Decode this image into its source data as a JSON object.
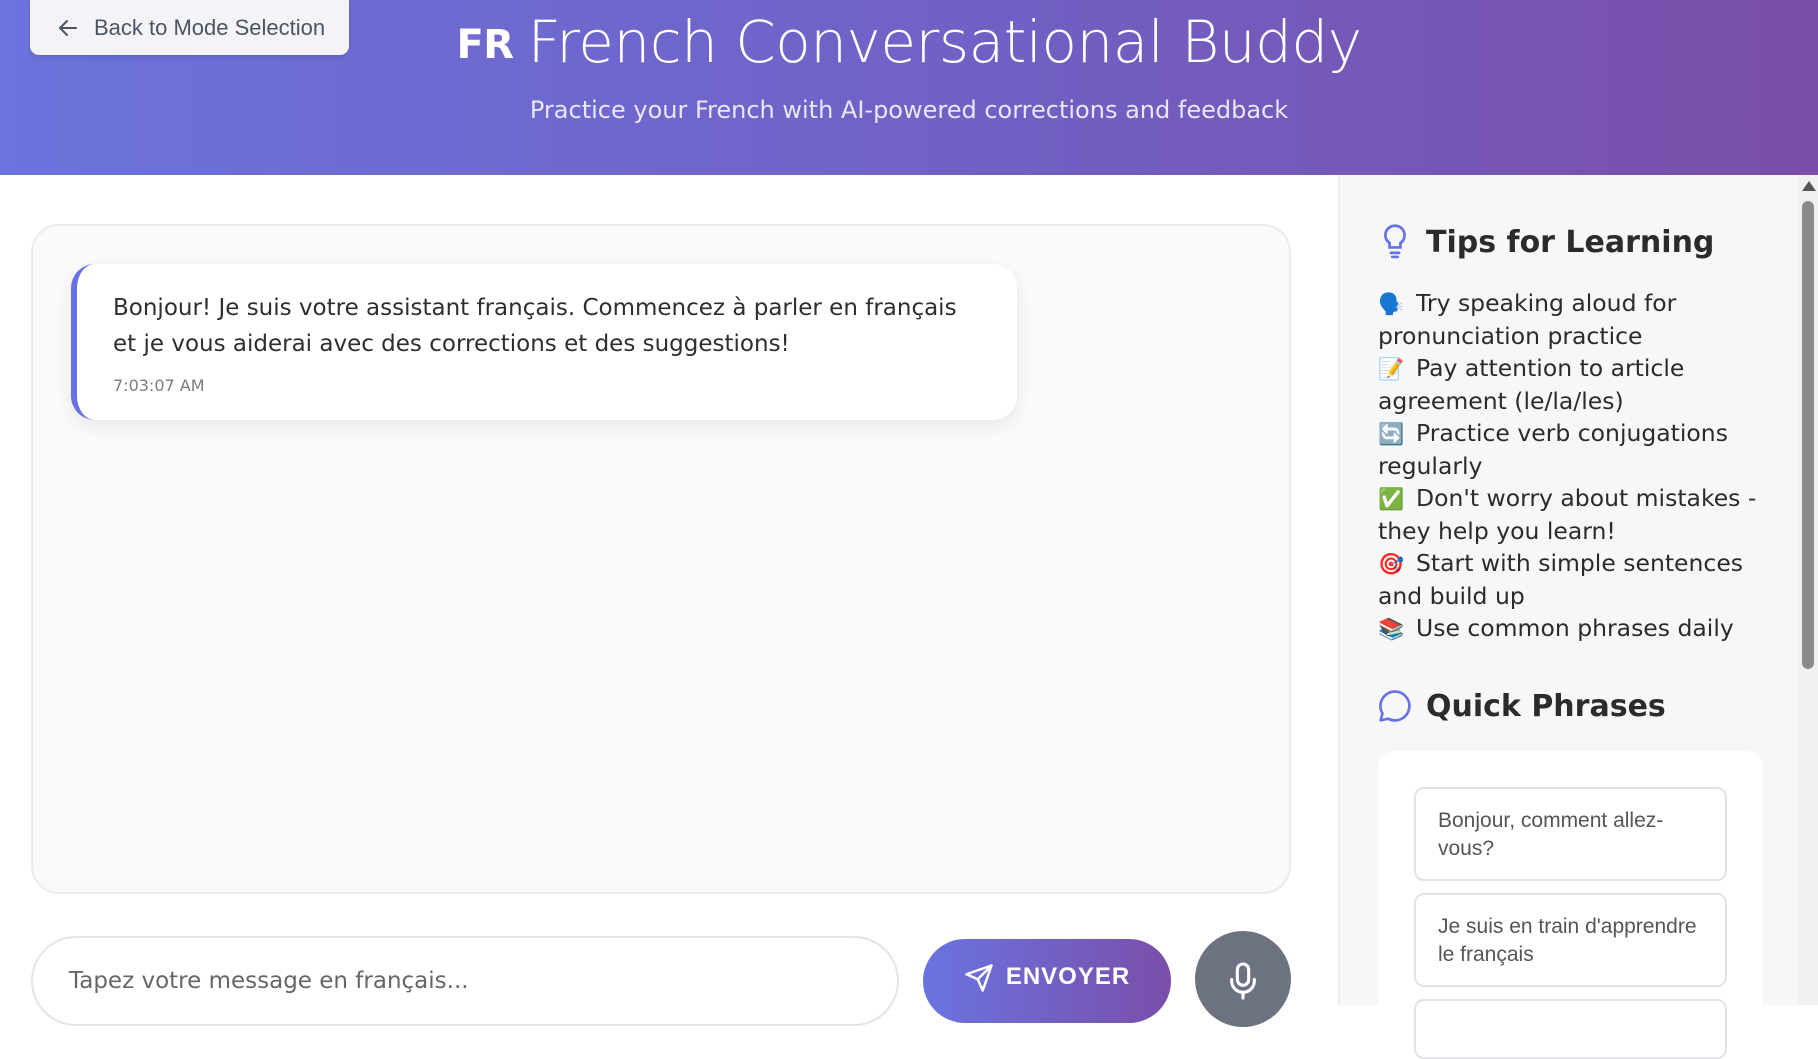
{
  "header": {
    "back_label": "Back to Mode Selection",
    "flag": "FR",
    "title": "French Conversational Buddy",
    "subtitle": "Practice your French with AI-powered corrections and feedback"
  },
  "chat": {
    "messages": [
      {
        "text": "Bonjour! Je suis votre assistant français. Commencez à parler en français et je vous aiderai avec des corrections et des suggestions!",
        "time": "7:03:07 AM"
      }
    ]
  },
  "composer": {
    "placeholder": "Tapez votre message en français...",
    "send_label": "ENVOYER"
  },
  "sidebar": {
    "tips_title": "Tips for Learning",
    "tips": [
      {
        "icon": "🗣️",
        "text": "Try speaking aloud for pronunciation practice"
      },
      {
        "icon": "📝",
        "text": "Pay attention to article agreement (le/la/les)"
      },
      {
        "icon": "🔄",
        "text": "Practice verb conjugations regularly"
      },
      {
        "icon": "✅",
        "text": "Don't worry about mistakes - they help you learn!"
      },
      {
        "icon": "🎯",
        "text": "Start with simple sentences and build up"
      },
      {
        "icon": "📚",
        "text": "Use common phrases daily"
      }
    ],
    "phrases_title": "Quick Phrases",
    "phrases": [
      "Bonjour, comment allez-vous?",
      "Je suis en train d'apprendre le français",
      ""
    ]
  },
  "colors": {
    "header_start": "#6b73dc",
    "header_end": "#7a4ea8",
    "accent": "#6772e5",
    "mic_button": "#6c7280"
  },
  "icons": {
    "back": "arrow-left-icon",
    "send": "paper-plane-icon",
    "mic": "microphone-icon",
    "tips": "lightbulb-icon",
    "phrases": "chat-bubble-icon"
  }
}
